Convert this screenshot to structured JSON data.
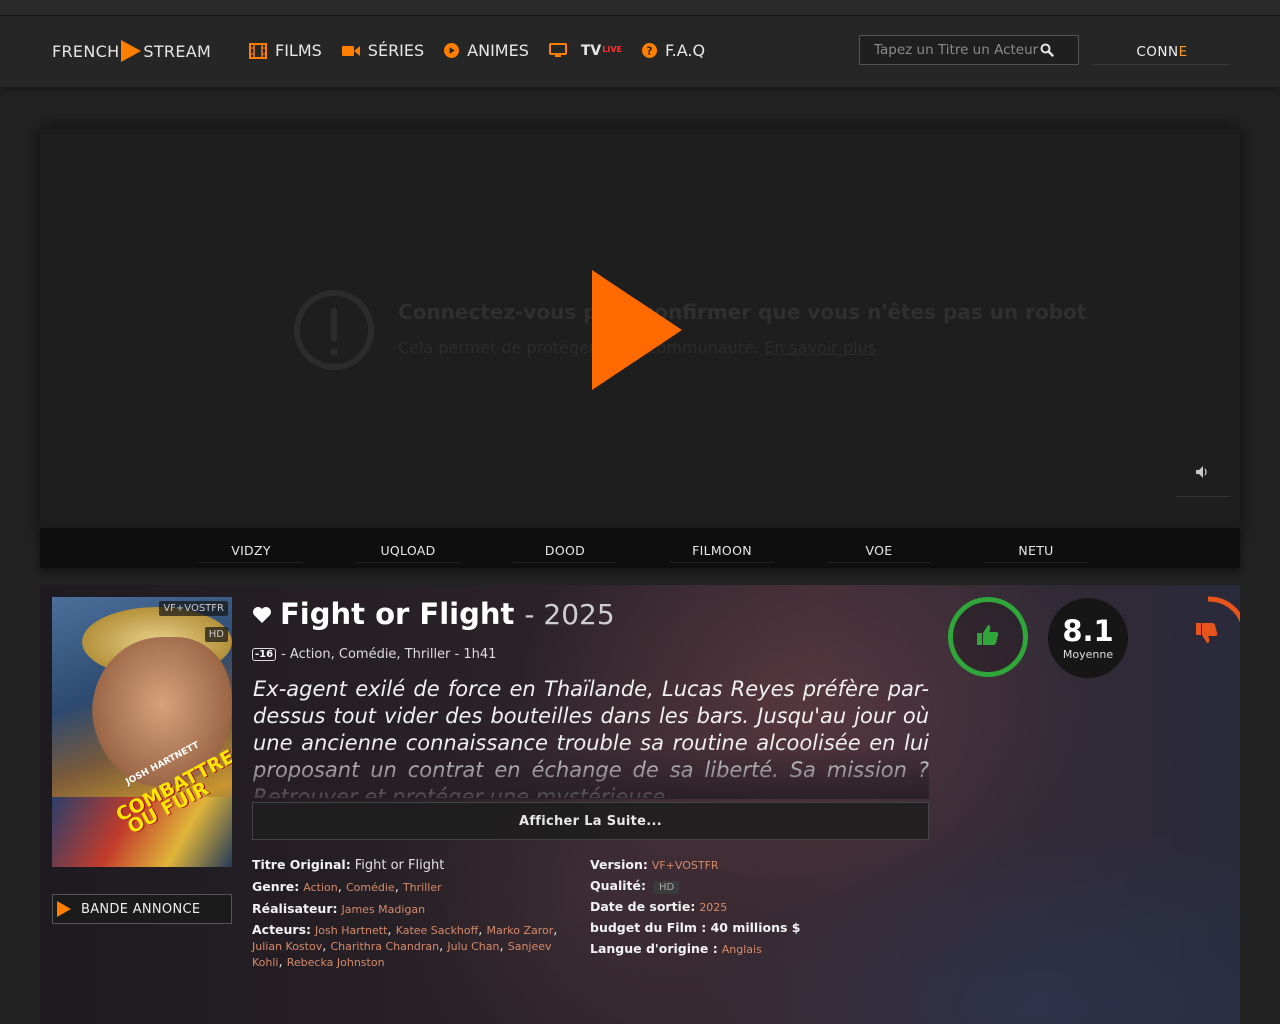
{
  "header": {
    "logo_left": "FRENCH",
    "logo_right": "STREAM",
    "nav": [
      {
        "label": "FILMS",
        "icon": "film-icon"
      },
      {
        "label": "SÉRIES",
        "icon": "video-camera-icon"
      },
      {
        "label": "ANIMES",
        "icon": "play-circle-icon"
      },
      {
        "label": "TV",
        "badge": "LIVE",
        "icon": "tv-icon"
      },
      {
        "label": "F.A.Q",
        "icon": "question-circle-icon"
      }
    ],
    "search_placeholder": "Tapez un Titre un Acteur",
    "login_main": "CONN",
    "login_accent": "E"
  },
  "player": {
    "captcha_title": "Connectez-vous pour confirmer que vous n'êtes pas un robot",
    "captcha_sub": "Cela permet de protéger notre communauté.",
    "captcha_link": "En savoir plus"
  },
  "servers": [
    "VIDZY",
    "UQLOAD",
    "DOOD",
    "FILMOON",
    "VOE",
    "NETU"
  ],
  "movie": {
    "title": "Fight or Flight",
    "year_sep": "- 2025",
    "age": "-16",
    "meta": "- Action, Comédie, Thriller - 1h41",
    "synopsis": "Ex-agent exilé de force en Thaïlande, Lucas Reyes préfère par-dessus tout vider des bouteilles dans les bars. Jusqu'au jour où une ancienne connaissance trouble sa routine alcoolisée en lui proposant un contrat en échange de sa liberté. Sa mission ? Retrouver et protéger une mystérieuse",
    "more_label": "Afficher La Suite...",
    "poster_badge_version": "VF+VOSTFR",
    "poster_badge_quality": "HD",
    "poster_actor": "JOSH HARTNETT",
    "poster_title_1": "COMBATTRE",
    "poster_title_2": "OU FUIR",
    "trailer_label": "BANDE ANNONCE",
    "details_left": {
      "original_title_label": "Titre Original:",
      "original_title": "Fight or Flight",
      "genre_label": "Genre:",
      "genres": [
        "Action",
        "Comédie",
        "Thriller"
      ],
      "director_label": "Réalisateur:",
      "director": "James Madigan",
      "actors_label": "Acteurs:",
      "actors": [
        "Josh Hartnett",
        "Katee Sackhoff",
        "Marko Zaror",
        "Julian Kostov",
        "Charithra Chandran",
        "Julu Chan",
        "Sanjeev Kohli",
        "Rebecka Johnston"
      ]
    },
    "details_right": {
      "version_label": "Version:",
      "version": "VF+VOSTFR",
      "quality_label": "Qualité:",
      "quality": "HD",
      "release_label": "Date de sortie:",
      "release": "2025",
      "budget_label": "budget du Film : 40 millions $",
      "language_label": "Langue d'origine :",
      "language": "Anglais"
    },
    "rating_value": "8.1",
    "rating_label": "Moyenne",
    "like_ratio": 1.0,
    "dislike_ratio": 0.2
  },
  "colors": {
    "accent": "#ff7f00",
    "play": "#ff6a00",
    "like": "#2fa53a",
    "dislike": "#e8551c",
    "link": "#d58a6a"
  }
}
